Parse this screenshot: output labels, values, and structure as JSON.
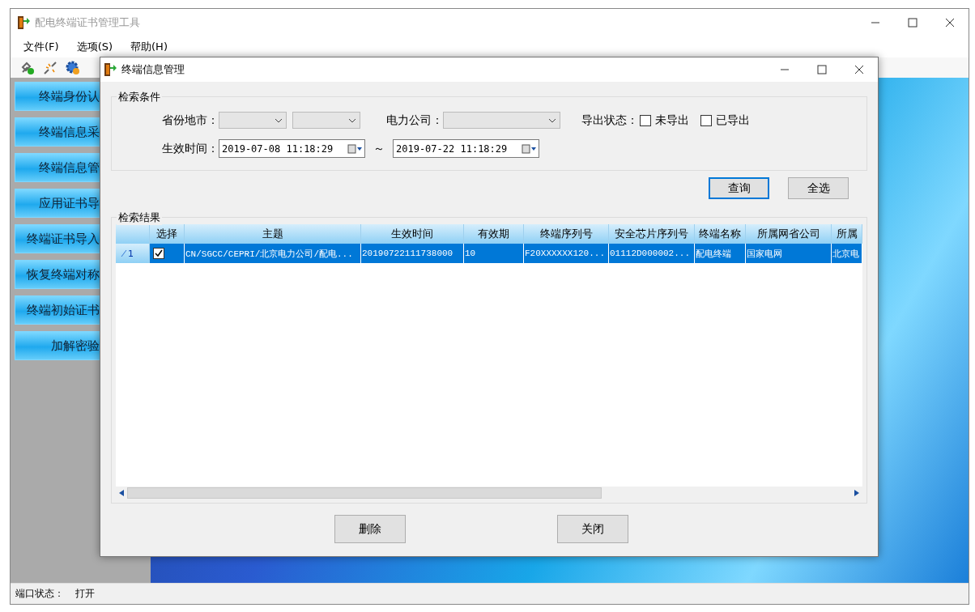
{
  "app_window": {
    "title": "配电终端证书管理工具",
    "menu": [
      "文件(F)",
      "选项(S)",
      "帮助(H)"
    ],
    "side_buttons": [
      "终端身份认",
      "终端信息采",
      "终端信息管",
      "应用证书导",
      "终端证书导入",
      "恢复终端对称",
      "终端初始证书",
      "加解密验"
    ],
    "status_bar": {
      "label": "端口状态：",
      "value": "打开"
    }
  },
  "dialog": {
    "title": "终端信息管理",
    "search_group": {
      "title": "检索条件",
      "province_label": "省份地市：",
      "company_label": "电力公司：",
      "export_status_label": "导出状态：",
      "export_options": [
        {
          "label": "未导出",
          "checked": false
        },
        {
          "label": "已导出",
          "checked": false
        }
      ],
      "time_label": "生效时间：",
      "start_time": "2019-07-08 11:18:29",
      "separator": "～",
      "end_time": "2019-07-22 11:18:29"
    },
    "action_buttons": [
      {
        "label": "查询",
        "focused": true
      },
      {
        "label": "全选",
        "focused": false
      }
    ],
    "results": {
      "title": "检索结果",
      "select_column": "选择",
      "columns": [
        "主题",
        "生效时间",
        "有效期",
        "终端序列号",
        "安全芯片序列号",
        "终端名称",
        "所属网省公司",
        "所属"
      ],
      "rows": [
        {
          "index": "1",
          "selected": true,
          "checked": true,
          "cells": [
            "CN/SGCC/CEPRI/北京电力公司/配电...",
            "20190722111738000",
            "10",
            "F20XXXXXX120...",
            "01112D000002...",
            "配电终端",
            "国家电网",
            "北京电"
          ]
        }
      ]
    },
    "bottom_buttons": [
      "删除",
      "关闭"
    ]
  }
}
